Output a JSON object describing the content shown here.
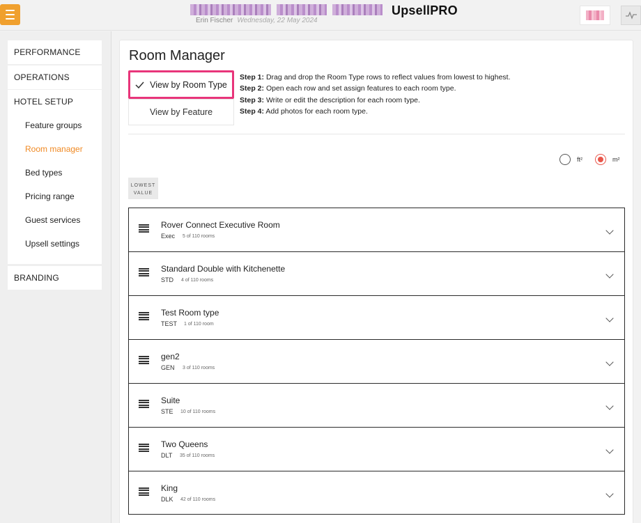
{
  "header": {
    "brand": "UpsellPRO",
    "user_name": "Erin Fischer",
    "date": "Wednesday, 22 May 2024"
  },
  "sidebar": {
    "groups": [
      {
        "label": "PERFORMANCE"
      },
      {
        "label": "OPERATIONS"
      },
      {
        "label": "HOTEL SETUP",
        "items": [
          {
            "label": "Feature groups"
          },
          {
            "label": "Room manager",
            "active": true
          },
          {
            "label": "Bed types"
          },
          {
            "label": "Pricing range"
          },
          {
            "label": "Guest services"
          },
          {
            "label": "Upsell settings"
          }
        ]
      },
      {
        "label": "BRANDING"
      }
    ]
  },
  "main": {
    "title": "Room Manager",
    "view_by_room_type": "View by Room Type",
    "view_by_feature": "View by Feature",
    "steps": [
      {
        "label": "Step 1:",
        "text": "Drag and drop the Room Type rows to reflect values from lowest to highest."
      },
      {
        "label": "Step 2:",
        "text": "Open each row and set assign features to each room type."
      },
      {
        "label": "Step 3:",
        "text": "Write or edit the description for each room type."
      },
      {
        "label": "Step 4:",
        "text": "Add photos for each room type."
      }
    ],
    "units": {
      "ft": "ft²",
      "m": "m²",
      "selected": "m²"
    },
    "lowest_value_line1": "LOWEST",
    "lowest_value_line2": "VALUE",
    "rooms": [
      {
        "name": "Rover Connect Executive Room",
        "code": "Exec",
        "count": "5 of 110 rooms"
      },
      {
        "name": "Standard Double with Kitchenette",
        "code": "STD",
        "count": "4 of 110 rooms"
      },
      {
        "name": "Test Room type",
        "code": "TEST",
        "count": "1 of 110 room"
      },
      {
        "name": "gen2",
        "code": "GEN",
        "count": "3 of 110 rooms"
      },
      {
        "name": "Suite",
        "code": "STE",
        "count": "10 of 110 rooms"
      },
      {
        "name": "Two Queens",
        "code": "DLT",
        "count": "35 of 110 rooms"
      },
      {
        "name": "King",
        "code": "DLK",
        "count": "42 of 110 rooms"
      }
    ]
  },
  "colors": {
    "accent": "#f08a24",
    "highlight": "#e8357a",
    "radio": "#e8564a"
  }
}
